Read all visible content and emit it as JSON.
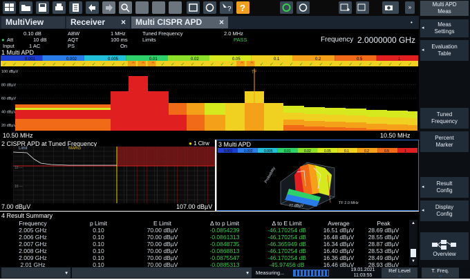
{
  "app": {
    "softkey_title": "Multi APD\nMeas"
  },
  "tabs": [
    {
      "label": "MultiView"
    },
    {
      "label": "Receiver",
      "close": "×"
    },
    {
      "label": "Multi CISPR APD",
      "close": "×"
    }
  ],
  "info": {
    "ref_level": "0.10 dB",
    "att_label": "Att",
    "att_value": "10 dB",
    "input_label": "Input",
    "input_value": "1 AC",
    "abw_label": "ABW",
    "abw_value": "1 MHz",
    "aqt_label": "AQT",
    "aqt_value": "100 ms",
    "ps_label": "PS",
    "ps_value": "On",
    "tuned_label": "Tuned Frequency",
    "tuned_value": "2.0 MHz",
    "limits_label": "Limits",
    "limits_value": "PASS",
    "frequency_label": "Frequency",
    "frequency_value": "2.0000000 GHz"
  },
  "panel1": {
    "title": "1 Multi APD",
    "scale": [
      "0.001",
      "0.002",
      "0.005",
      "0.01",
      "0.02",
      "0.05",
      "0.1",
      "0.2",
      "0.5",
      "1"
    ],
    "y_labels": [
      "100 dBµV",
      "80 dBµV",
      "60 dBµV",
      "40 dBµV",
      "20 dBµV"
    ],
    "x_start": "10.50 MHz",
    "x_stop": "10.50 MHz",
    "marker_label": "TF"
  },
  "panel2": {
    "title": "2 CISPR APD at Tuned Frequency",
    "legend": "1 Clrw",
    "limit_label": "Limit",
    "marg_label": "MARG",
    "y_min": "7.00 dBµV",
    "y_max": "107.00 dBµV"
  },
  "panel3": {
    "title": "3 Multi APD",
    "scale": [
      "0.001",
      "0.002",
      "0.005",
      "0.01",
      "0.02",
      "0.05",
      "0.1",
      "0.2",
      "0.5",
      "1"
    ],
    "axis_probability": "Probability",
    "axis_tf": "TF 2.0 MHz",
    "axis_level": "77 dBµV"
  },
  "panel4": {
    "title": "4 Result Summary",
    "columns": [
      "Frequency",
      "p Limit",
      "E Limit",
      "Δ to p Limit",
      "Δ to E Limit",
      "Average",
      "Peak"
    ],
    "rows": [
      [
        "2.005 GHz",
        "0.10",
        "70.00 dBµV",
        "-0.0854239",
        "-46.170254 dB",
        "16.51 dBµV",
        "28.69 dBµV"
      ],
      [
        "2.006 GHz",
        "0.10",
        "70.00 dBµV",
        "-0.0861313",
        "-46.170254 dB",
        "16.48 dBµV",
        "28.55 dBµV"
      ],
      [
        "2.007 GHz",
        "0.10",
        "70.00 dBµV",
        "-0.0848735",
        "-46.365949 dB",
        "16.34 dBµV",
        "28.87 dBµV"
      ],
      [
        "2.008 GHz",
        "0.10",
        "70.00 dBµV",
        "-0.0868813",
        "-46.170254 dB",
        "16.40 dBµV",
        "28.53 dBµV"
      ],
      [
        "2.009 GHz",
        "0.10",
        "70.00 dBµV",
        "-0.0875547",
        "-46.170254 dB",
        "16.36 dBµV",
        "28.49 dBµV"
      ],
      [
        "2.01 GHz",
        "0.10",
        "70.00 dBµV",
        "-0.0885313",
        "-45.97456 dB",
        "16.46 dBµV",
        "28.93 dBµV"
      ]
    ]
  },
  "softkeys": [
    {
      "label": "Meas\nSettings"
    },
    {
      "label": "Evaluation\nTable"
    },
    {
      "label": "Tuned\nFrequency"
    },
    {
      "label": "Percent\nMarker"
    },
    {
      "label": "Result\nConfig"
    },
    {
      "label": "Display\nConfig"
    },
    {
      "label": "Overview"
    }
  ],
  "status": {
    "measuring": "Measuring...",
    "date": "19.01.2021",
    "time": "11:03:55",
    "ref_level": "Ref Level",
    "t_freq": "T. Freq."
  },
  "colors": {
    "accent": "#2a6fd6",
    "pass": "#36d14b",
    "bg": "#000000"
  }
}
